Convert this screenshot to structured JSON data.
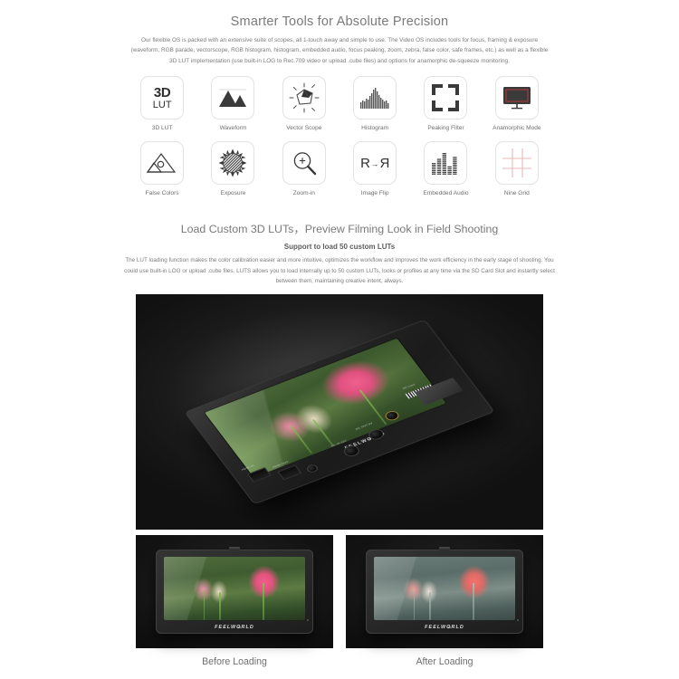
{
  "section1": {
    "heading": "Smarter Tools for Absolute Precision",
    "intro": "Our flexible OS is packed with an extensive suite of scopes, all 1-touch away and simple to use. The Video OS includes tools for focus, framing & exposure (waveform, RGB parade, vectorscope, RGB histogram, histogram, embedded audio, focus peaking, zoom, zebra, false color, safe frames, etc.) as well as a flexible 3D LUT implementation (use built-in LOG to Rec.709 video or upload .cube files) and options for anamorphic de-squeeze monitoring.",
    "features": [
      {
        "label": "3D LUT",
        "icon": "3d-lut-icon",
        "text_top": "3D",
        "text_bottom": "LUT"
      },
      {
        "label": "Waveform",
        "icon": "waveform-icon"
      },
      {
        "label": "Vector Scope",
        "icon": "vector-scope-icon"
      },
      {
        "label": "Histogram",
        "icon": "histogram-icon"
      },
      {
        "label": "Peaking Filter",
        "icon": "peaking-filter-icon"
      },
      {
        "label": "Anamorphic Mode",
        "icon": "anamorphic-mode-icon"
      },
      {
        "label": "False Colors",
        "icon": "false-colors-icon"
      },
      {
        "label": "Exposure",
        "icon": "exposure-icon"
      },
      {
        "label": "Zoom-in",
        "icon": "zoom-in-icon"
      },
      {
        "label": "Image Flip",
        "icon": "image-flip-icon",
        "glyph": "R"
      },
      {
        "label": "Embedded Audio",
        "icon": "embedded-audio-icon"
      },
      {
        "label": "Nine Grid",
        "icon": "nine-grid-icon"
      }
    ]
  },
  "section2": {
    "heading": "Load Custom 3D LUTs，Preview Filming Look in Field Shooting",
    "subheading": "Support to load 50 custom LUTs",
    "body": "The LUT loading function makes the color calibration easier and more intuitive, optimizes the workflow and improves the work efficiency in the early stage of shooting. You could use built-in LOG or upload .cube files. LUTS allows you to load internally up to 50 custom LUTs, looks or profiles at any time via the SD Card Slot and instantly select between them, maintaining creative intent, always."
  },
  "hero": {
    "brand": "FEELWRLD",
    "brand_pre": "FEELW",
    "brand_o": "O",
    "brand_post": "RLD",
    "ports": [
      {
        "name": "hdmi-in-port",
        "label": "HDMI IN"
      },
      {
        "name": "hdmi-out-port",
        "label": "HDMI OUT"
      },
      {
        "name": "dc-in-port",
        "label": "DC IN 12V"
      },
      {
        "name": "dc-out-port",
        "label": "DC OUT 8V"
      },
      {
        "name": "sd-card-slot",
        "label": "SD Card"
      }
    ]
  },
  "compare": {
    "before": {
      "caption": "Before Loading",
      "brand": "FEELWORLD"
    },
    "after": {
      "caption": "After Loading",
      "brand": "FEELWORLD"
    }
  },
  "colors": {
    "page_bg": "#ffffff",
    "heading": "#7a7a7a",
    "body_text": "#7c7c7c",
    "tile_border": "#e3e3e3",
    "icon_dark": "#2f2f2f",
    "nine_grid": "#eab8b8",
    "anamorphic_red": "#b23a3a",
    "photo_bg": "#121212"
  }
}
